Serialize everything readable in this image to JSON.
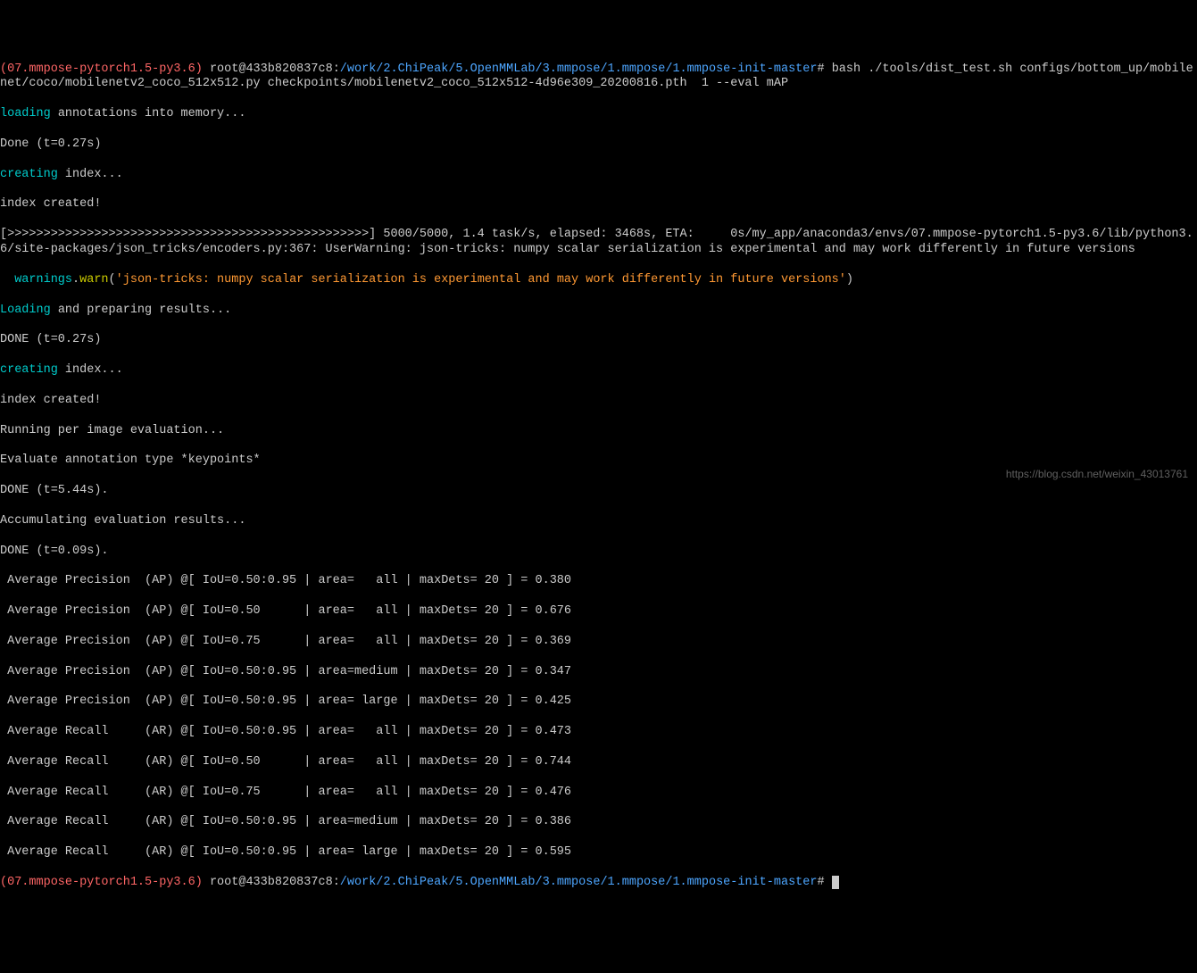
{
  "prompt1": {
    "env": "(07.mmpose-pytorch1.5-py3.6) ",
    "userhost": "root@433b820837c8",
    "colon": ":",
    "path": "/work/2.ChiPeak/5.OpenMMLab/3.mmpose/1.mmpose/1.mmpose-init-master",
    "hash": "# ",
    "command": "bash ./tools/dist_test.sh configs/bottom_up/mobilenet/coco/mobilenetv2_coco_512x512.py checkpoints/mobilenetv2_coco_512x512-4d96e309_20200816.pth  1 --eval mAP"
  },
  "loading_prefix": "loading",
  "loading_suffix": " annotations into memory...",
  "done1": "Done (t=0.27s)",
  "creating_prefix": "creating",
  "creating_suffix": " index...",
  "index_created": "index created!",
  "progress": "[>>>>>>>>>>>>>>>>>>>>>>>>>>>>>>>>>>>>>>>>>>>>>>>>>>] 5000/5000, 1.4 task/s, elapsed: 3468s, ETA:     0s",
  "warning_path": "/my_app/anaconda3/envs/07.mmpose-pytorch1.5-py3.6/lib/python3.6/site-packages/json_tricks/encoders.py:367: UserWarning: json-tricks: numpy scalar serialization is experimental and may work differently in future versions",
  "warn_prefix": "  warnings",
  "warn_dot": ".",
  "warn_func": "warn",
  "warn_paren": "(",
  "warn_msg": "'json-tricks: numpy scalar serialization is experimental and may work differently in future versions'",
  "warn_close": ")",
  "loading_results_prefix": "Loading",
  "loading_results_suffix": " and preparing results...",
  "done2": "DONE (t=0.27s)",
  "running_eval": "Running per image evaluation...",
  "eval_type": "Evaluate annotation type *keypoints*",
  "done3": "DONE (t=5.44s).",
  "accumulating": "Accumulating evaluation results...",
  "done4": "DONE (t=0.09s).",
  "metrics": [
    " Average Precision  (AP) @[ IoU=0.50:0.95 | area=   all | maxDets= 20 ] = 0.380",
    " Average Precision  (AP) @[ IoU=0.50      | area=   all | maxDets= 20 ] = 0.676",
    " Average Precision  (AP) @[ IoU=0.75      | area=   all | maxDets= 20 ] = 0.369",
    " Average Precision  (AP) @[ IoU=0.50:0.95 | area=medium | maxDets= 20 ] = 0.347",
    " Average Precision  (AP) @[ IoU=0.50:0.95 | area= large | maxDets= 20 ] = 0.425",
    " Average Recall     (AR) @[ IoU=0.50:0.95 | area=   all | maxDets= 20 ] = 0.473",
    " Average Recall     (AR) @[ IoU=0.50      | area=   all | maxDets= 20 ] = 0.744",
    " Average Recall     (AR) @[ IoU=0.75      | area=   all | maxDets= 20 ] = 0.476",
    " Average Recall     (AR) @[ IoU=0.50:0.95 | area=medium | maxDets= 20 ] = 0.386",
    " Average Recall     (AR) @[ IoU=0.50:0.95 | area= large | maxDets= 20 ] = 0.595"
  ],
  "prompt2": {
    "env": "(07.mmpose-pytorch1.5-py3.6) ",
    "userhost": "root@433b820837c8",
    "colon": ":",
    "path": "/work/2.ChiPeak/5.OpenMMLab/3.mmpose/1.mmpose/1.mmpose-init-master",
    "hash": "# "
  },
  "watermark": "https://blog.csdn.net/weixin_43013761"
}
